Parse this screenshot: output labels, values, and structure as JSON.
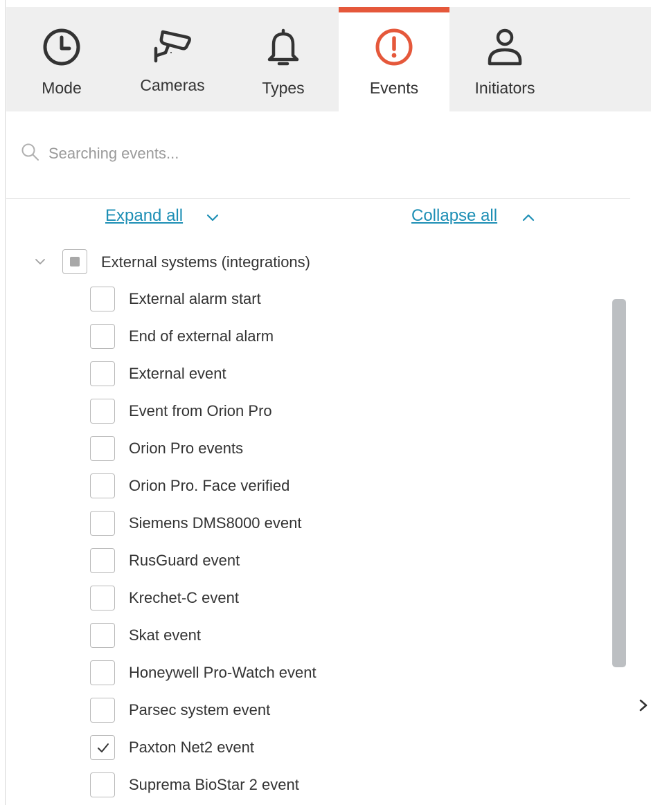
{
  "tabs": [
    {
      "label": "Mode",
      "icon": "clock-icon"
    },
    {
      "label": "Cameras",
      "icon": "camera-icon"
    },
    {
      "label": "Types",
      "icon": "bell-icon"
    },
    {
      "label": "Events",
      "icon": "alert-circle-icon",
      "active": true
    },
    {
      "label": "Initiators",
      "icon": "person-icon"
    }
  ],
  "accent_color": "#e5583b",
  "link_color": "#1e8fb5",
  "search": {
    "placeholder": "Searching events...",
    "value": ""
  },
  "controls": {
    "expand_all": "Expand all",
    "collapse_all": "Collapse all"
  },
  "tree": {
    "group_label": "External systems (integrations)",
    "group_state": "partial",
    "items": [
      {
        "label": "External alarm start",
        "checked": false
      },
      {
        "label": "End of external alarm",
        "checked": false
      },
      {
        "label": "External event",
        "checked": false
      },
      {
        "label": "Event from Orion Pro",
        "checked": false
      },
      {
        "label": "Orion Pro events",
        "checked": false
      },
      {
        "label": "Orion Pro. Face verified",
        "checked": false
      },
      {
        "label": "Siemens DMS8000 event",
        "checked": false
      },
      {
        "label": "RusGuard event",
        "checked": false
      },
      {
        "label": "Krechet-C event",
        "checked": false
      },
      {
        "label": "Skat event",
        "checked": false
      },
      {
        "label": "Honeywell Pro-Watch event",
        "checked": false
      },
      {
        "label": "Parsec system event",
        "checked": false
      },
      {
        "label": "Paxton Net2 event",
        "checked": true
      },
      {
        "label": "Suprema BioStar 2 event",
        "checked": false
      }
    ]
  }
}
